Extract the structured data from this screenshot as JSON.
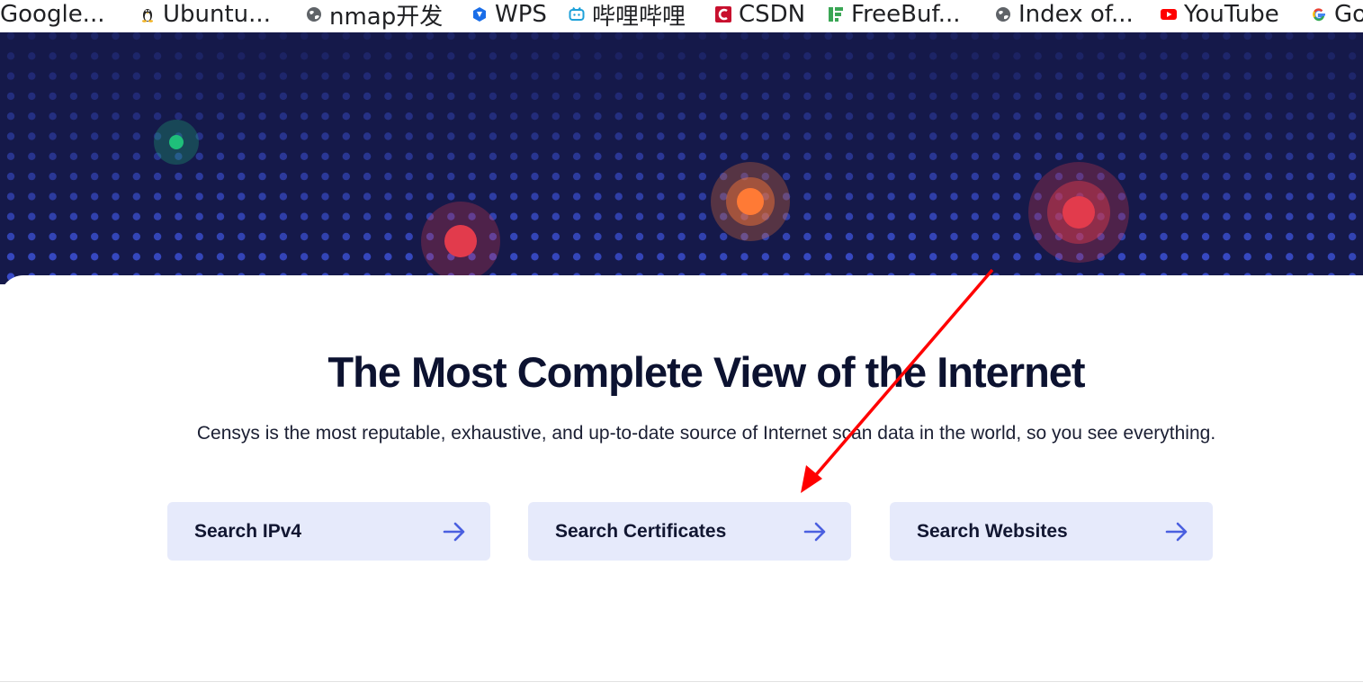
{
  "bookmarks": [
    {
      "label": "Google...",
      "icon": "none"
    },
    {
      "label": "Ubuntu...",
      "icon": "linux-penguin-icon"
    },
    {
      "label": "nmap开发",
      "icon": "globe-icon"
    },
    {
      "label": "WPS",
      "icon": "wps-icon"
    },
    {
      "label": "哔哩哔哩",
      "icon": "bilibili-icon"
    },
    {
      "label": "CSDN",
      "icon": "csdn-icon"
    },
    {
      "label": "FreeBuf...",
      "icon": "freebuf-icon"
    },
    {
      "label": "Index of...",
      "icon": "globe-icon"
    },
    {
      "label": "YouTube",
      "icon": "youtube-icon"
    },
    {
      "label": "Go",
      "icon": "google-icon"
    }
  ],
  "hero": {
    "background": "#15194a",
    "dot_color": "#3b4fd0",
    "markers": [
      {
        "color": "#1fbf7a",
        "name": "green-marker"
      },
      {
        "color": "#e23b4c",
        "name": "red-marker"
      },
      {
        "color": "#ff7a35",
        "name": "orange-marker"
      },
      {
        "color": "#e23b4c",
        "name": "red-marker"
      }
    ]
  },
  "main": {
    "title": "The Most Complete View of the Internet",
    "subtitle": "Censys is the most reputable, exhaustive, and up-to-date source of Internet scan data in the world, so you see everything.",
    "buttons": [
      {
        "label": "Search IPv4",
        "icon": "arrow-right-icon"
      },
      {
        "label": "Search Certificates",
        "icon": "arrow-right-icon"
      },
      {
        "label": "Search Websites",
        "icon": "arrow-right-icon"
      }
    ]
  },
  "colors": {
    "accent": "#4a5fe0",
    "button_bg": "#e6eafb",
    "title": "#0c1230",
    "annotation_arrow": "#ff0000"
  }
}
